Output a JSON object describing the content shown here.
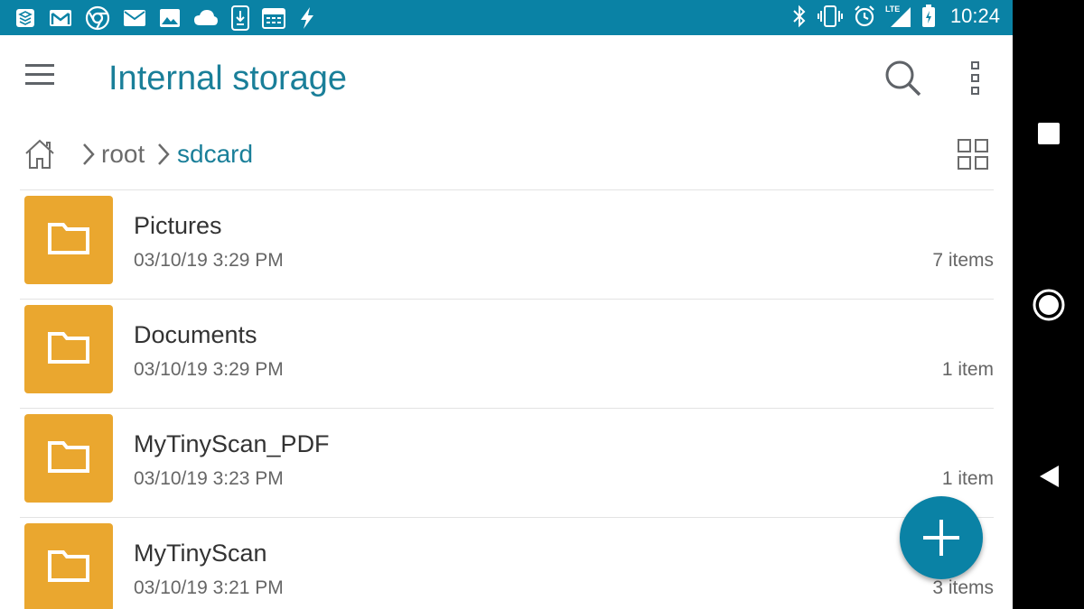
{
  "status_bar": {
    "time": "10:24",
    "left_icons": [
      "layers-icon",
      "gmail-icon",
      "chrome-icon",
      "mail-icon",
      "photo-icon",
      "cloud-icon",
      "download-icon",
      "calendar-icon",
      "bolt-icon"
    ],
    "right_icons": [
      "bluetooth-icon",
      "vibrate-icon",
      "alarm-icon",
      "lte-signal-icon",
      "battery-charging-icon"
    ],
    "lte_label": "LTE"
  },
  "app_bar": {
    "title": "Internal storage"
  },
  "breadcrumb": {
    "items": [
      {
        "label": "root"
      },
      {
        "label": "sdcard"
      }
    ]
  },
  "files": [
    {
      "name": "Pictures",
      "date": "03/10/19 3:29 PM",
      "count": "7 items"
    },
    {
      "name": "Documents",
      "date": "03/10/19 3:29 PM",
      "count": "1 item"
    },
    {
      "name": "MyTinyScan_PDF",
      "date": "03/10/19 3:23 PM",
      "count": "1 item"
    },
    {
      "name": "MyTinyScan",
      "date": "03/10/19 3:21 PM",
      "count": "3 items"
    }
  ],
  "colors": {
    "accent": "#0a82a5",
    "title": "#1a7f99",
    "folder": "#eaa72f"
  }
}
